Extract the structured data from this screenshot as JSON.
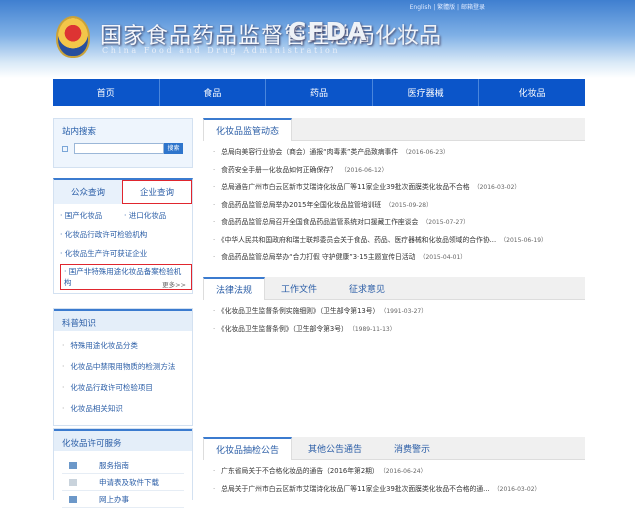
{
  "header": {
    "links": [
      "English",
      "繁體版",
      "邮箱登录"
    ],
    "title_cn": "国家食品药品监督管理总局",
    "title_en": "China Food and Drug Administration",
    "logo_text": "CFDA",
    "section": "化妆品"
  },
  "nav": [
    "首页",
    "食品",
    "药品",
    "医疗器械",
    "化妆品"
  ],
  "search": {
    "title": "站内搜索",
    "placeholder": "",
    "button": "搜索"
  },
  "query": {
    "tabs": [
      "公众查询",
      "企业查询"
    ],
    "links": [
      "国产化妆品",
      "进口化妆品",
      "化妆品行政许可检验机构",
      "化妆品生产许可获证企业",
      "国产非特殊用途化妆品备案检验机构"
    ],
    "more": "更多>>"
  },
  "knowledge": {
    "title": "科普知识",
    "items": [
      "特殊用途化妆品分类",
      "化妆品中禁限用物质的检测方法",
      "化妆品行政许可检验项目",
      "化妆品相关知识"
    ]
  },
  "service": {
    "title": "化妆品许可服务",
    "items": [
      "服务指南",
      "申请表及软件下载",
      "网上办事"
    ]
  },
  "news": {
    "tabs": [
      "化妆品监管动态"
    ],
    "items": [
      {
        "t": "总局向美容行业协会（商会）通报“肉毒素”类产品致病事件",
        "d": "（2016-06-23）"
      },
      {
        "t": "食药安全手册—化妆品如何正确保存？",
        "d": "（2016-06-12）"
      },
      {
        "t": "总局通告广州市白云区新市艾瑞诗化妆品厂等11家企业39批次面膜类化妆品不合格",
        "d": "（2016-03-02）"
      },
      {
        "t": "食品药品监管总局举办2015年全国化妆品监管培训班",
        "d": "（2015-09-28）"
      },
      {
        "t": "食品药品监管总局召开全国食品药品监管系统对口援藏工作座谈会",
        "d": "（2015-07-27）"
      },
      {
        "t": "《中华人民共和国政府和瑞士联邦委员会关于食品、药品、医疗器械和化妆品领域的合作协...",
        "d": "（2015-06-19）"
      },
      {
        "t": "食品药品监管总局举办“合力打假 守护健康”3·15主题宣传日活动",
        "d": "（2015-04-01）"
      }
    ]
  },
  "laws": {
    "tabs": [
      "法律法规",
      "工作文件",
      "征求意见"
    ],
    "items": [
      {
        "t": "《化妆品卫生监督条例实施细则》（卫生部令第13号）",
        "d": "（1991-03-27）"
      },
      {
        "t": "《化妆品卫生监督条例》（卫生部令第3号）",
        "d": "（1989-11-13）"
      }
    ]
  },
  "notices": {
    "tabs": [
      "化妆品抽检公告",
      "其他公告通告",
      "消费警示"
    ],
    "items": [
      {
        "t": "广东省局关于不合格化妆品的通告（2016年第2期）",
        "d": "（2016-06-24）"
      },
      {
        "t": "总局关于广州市白云区新市艾瑞诗化妆品厂等11家企业39批次面膜类化妆品不合格的通...",
        "d": "（2016-03-02）"
      }
    ]
  }
}
